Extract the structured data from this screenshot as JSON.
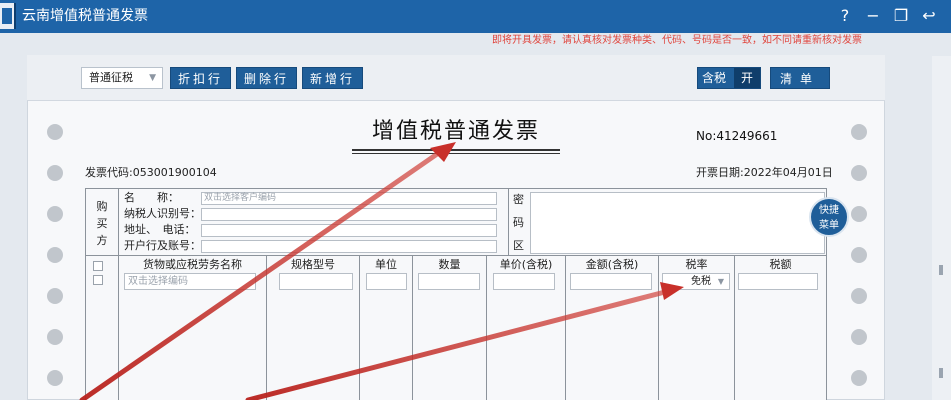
{
  "window": {
    "title": "云南增值税普通发票",
    "help_icon": "?",
    "minimize_icon": "−",
    "restore_icon": "❐",
    "back_icon": "↩"
  },
  "notice": "即将开具发票，请认真核对发票种类、代码、号码是否一致，如不同请重新核对发票",
  "toolbar": {
    "invoice_type_value": "普通征税",
    "discount_label": "折扣行",
    "delete_label": "删除行",
    "add_label": "新增行",
    "tax_incl_label": "含税",
    "tax_incl_state": "开",
    "clear_label": "清单"
  },
  "invoice": {
    "title": "增值税普通发票",
    "number": "No:41249661",
    "code": "发票代码:053001900104",
    "date": "开票日期:2022年04月01日"
  },
  "buyer": {
    "label": "购买方",
    "name_label": "名　　称：",
    "name_placeholder": "双击选择客户编码",
    "tax_id_label": "纳税人识别号：",
    "address_label": "地址、　电话：",
    "bank_label": "开户行及账号："
  },
  "cipher": {
    "c1": "密",
    "c2": "码",
    "c3": "区"
  },
  "items": {
    "headers": {
      "goods": "货物或应税劳务名称",
      "spec": "规格型号",
      "unit": "单位",
      "qty": "数量",
      "price": "单价(含税)",
      "amount": "金额(含税)",
      "rate": "税率",
      "tax": "税额"
    },
    "goods_placeholder": "双击选择编码",
    "rate_value": "免税"
  },
  "quick_menu": {
    "line1": "快捷",
    "line2": "菜单"
  },
  "colors": {
    "titlebar": "#1e64a8",
    "button": "#1f5e99",
    "notice": "#e0443c",
    "annotation_arrow": "#c8302a"
  }
}
